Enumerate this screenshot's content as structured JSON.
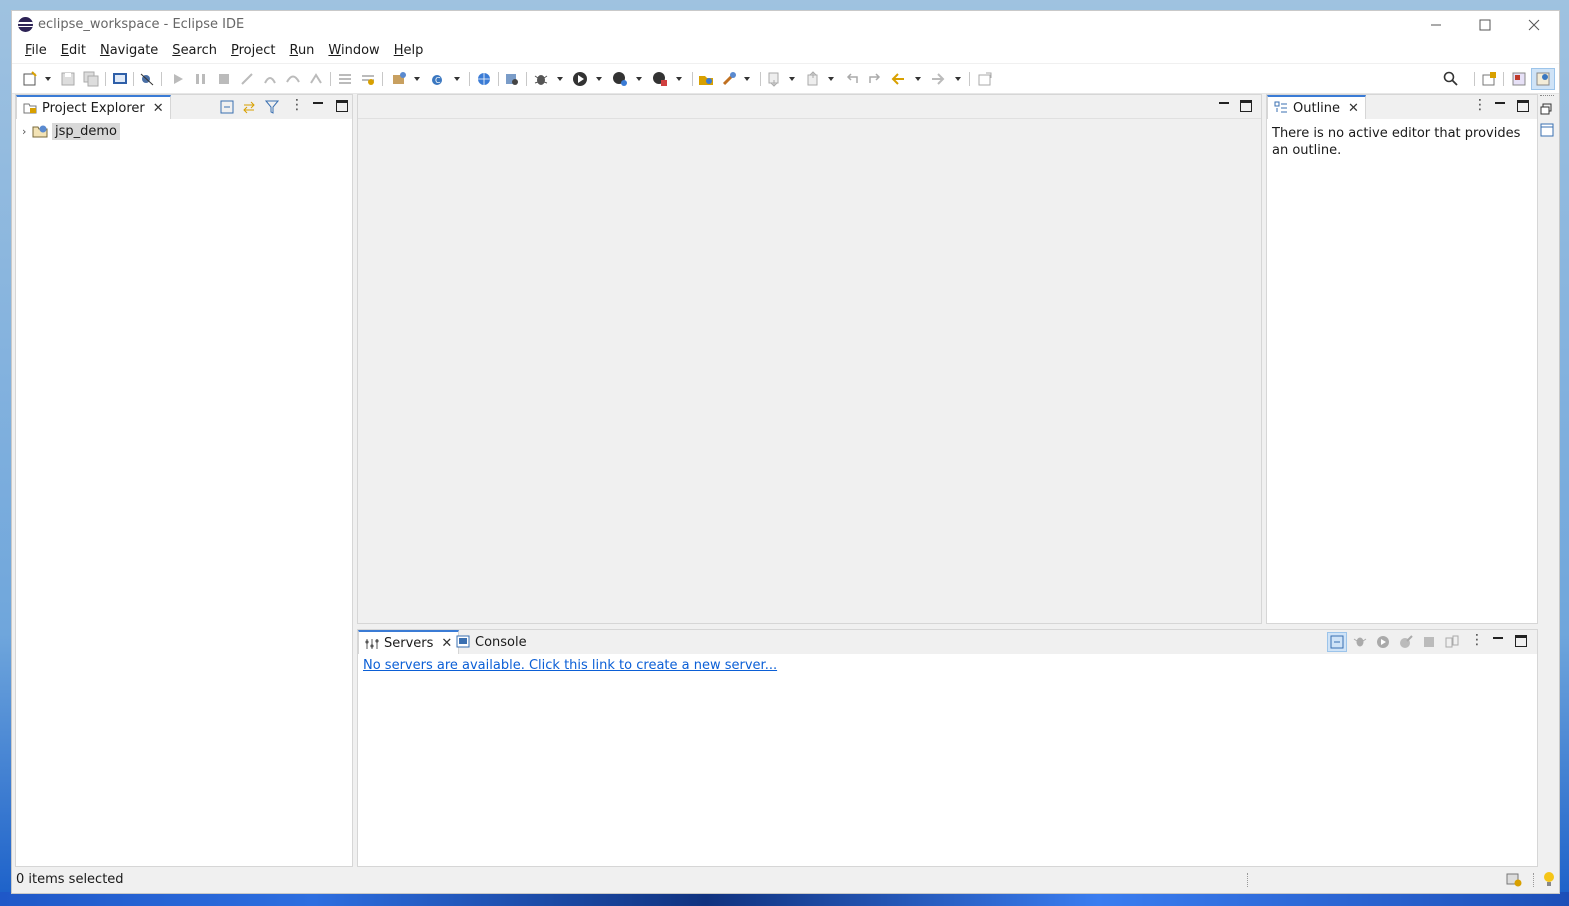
{
  "window": {
    "title": "eclipse_workspace - Eclipse IDE"
  },
  "menu": [
    "File",
    "Edit",
    "Navigate",
    "Search",
    "Project",
    "Run",
    "Window",
    "Help"
  ],
  "project_explorer": {
    "tab_label": "Project Explorer",
    "items": [
      {
        "label": "jsp_demo"
      }
    ]
  },
  "outline": {
    "tab_label": "Outline",
    "message": "There is no active editor that provides an outline."
  },
  "bottom": {
    "tabs": [
      {
        "label": "Servers"
      },
      {
        "label": "Console"
      }
    ],
    "servers_link": "No servers are available. Click this link to create a new server..."
  },
  "status": {
    "text": "0 items selected"
  },
  "colors": {
    "accent": "#3a7bd5",
    "link": "#0b5fd6"
  }
}
